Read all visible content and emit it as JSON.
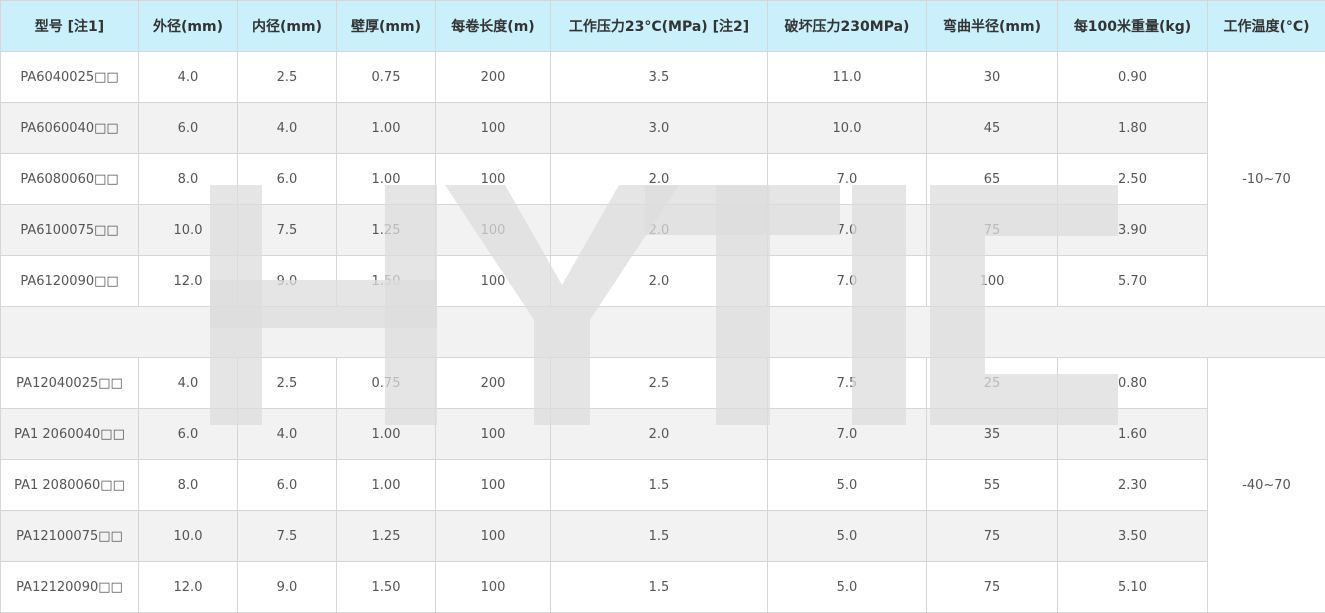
{
  "table": {
    "headers": [
      "型号 [注1]",
      "外径(mm)",
      "内径(mm)",
      "壁厚(mm)",
      "每卷长度(m)",
      "工作压力23°C(MPa) [注2]",
      "破坏压力230MPa)",
      "弯曲半径(mm)",
      "每100米重量(kg)",
      "工作温度(°C)"
    ],
    "groups": [
      {
        "temperature": "-10~70",
        "rows": [
          [
            "PA6040025□□",
            "4.0",
            "2.5",
            "0.75",
            "200",
            "3.5",
            "11.0",
            "30",
            "0.90"
          ],
          [
            "PA6060040□□",
            "6.0",
            "4.0",
            "1.00",
            "100",
            "3.0",
            "10.0",
            "45",
            "1.80"
          ],
          [
            "PA6080060□□",
            "8.0",
            "6.0",
            "1.00",
            "100",
            "2.0",
            "7.0",
            "65",
            "2.50"
          ],
          [
            "PA6100075□□",
            "10.0",
            "7.5",
            "1.25",
            "100",
            "2.0",
            "7.0",
            "75",
            "3.90"
          ],
          [
            "PA6120090□□",
            "12.0",
            "9.0",
            "1.50",
            "100",
            "2.0",
            "7.0",
            "100",
            "5.70"
          ]
        ]
      },
      {
        "temperature": "-40~70",
        "rows": [
          [
            "PA12040025□□",
            "4.0",
            "2.5",
            "0.75",
            "200",
            "2.5",
            "7.5",
            "25",
            "0.80"
          ],
          [
            "PA1 2060040□□",
            "6.0",
            "4.0",
            "1.00",
            "100",
            "2.0",
            "7.0",
            "35",
            "1.60"
          ],
          [
            "PA1 2080060□□",
            "8.0",
            "6.0",
            "1.00",
            "100",
            "1.5",
            "5.0",
            "55",
            "2.30"
          ],
          [
            "PA12100075□□",
            "10.0",
            "7.5",
            "1.25",
            "100",
            "1.5",
            "5.0",
            "75",
            "3.50"
          ],
          [
            "PA12120090□□",
            "12.0",
            "9.0",
            "1.50",
            "100",
            "1.5",
            "5.0",
            "75",
            "5.10"
          ]
        ]
      }
    ]
  },
  "watermark": {
    "text": "HYTIC",
    "color": "#e4e4e4"
  }
}
